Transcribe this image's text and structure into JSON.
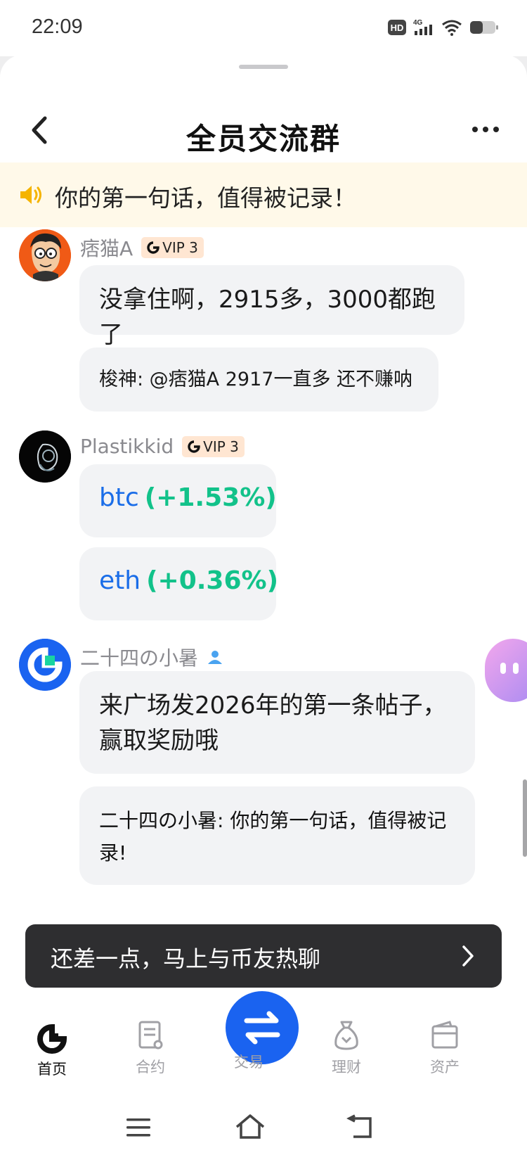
{
  "status_bar": {
    "time": "22:09",
    "network": "4G",
    "hd_label": "HD"
  },
  "header": {
    "title": "全员交流群",
    "back_icon": "chevron-left-icon",
    "more_icon": "more-horizontal-icon"
  },
  "notice": {
    "text": "你的第一句话，值得被记录！",
    "icon": "speaker-icon"
  },
  "messages": [
    {
      "user": "痞猫A",
      "badge": "VIP 3",
      "bubbles": [
        "没拿住啊，2915多，3000都跑了"
      ],
      "reply": "梭神: @痞猫A 2917一直多 还不赚呐"
    },
    {
      "user": "Plastikkid",
      "badge": "VIP 3",
      "tickers": [
        {
          "symbol": "btc",
          "change": "(+1.53%)"
        },
        {
          "symbol": "eth",
          "change": "(+0.36%)"
        }
      ]
    },
    {
      "user": "二十四の小暑",
      "badge_icon": "person-icon",
      "bubble_lines": [
        "来广场发2026年的第一条帖子，",
        "赢取奖励哦"
      ],
      "reply_lines": [
        "二十四の小暑: 你的第一句话，值得被记",
        "录!"
      ]
    }
  ],
  "cta": {
    "text": "还差一点，马上与币友热聊"
  },
  "tabs": [
    {
      "label": "首页",
      "icon": "home-logo-icon",
      "active": true
    },
    {
      "label": "合约",
      "icon": "contract-icon",
      "active": false
    },
    {
      "label": "交易",
      "icon": "swap-icon",
      "active": false
    },
    {
      "label": "理财",
      "icon": "money-bag-icon",
      "active": false
    },
    {
      "label": "资产",
      "icon": "wallet-icon",
      "active": false
    }
  ],
  "colors": {
    "accent": "#1a63f0",
    "positive": "#12c28a",
    "ticker": "#1a6de8",
    "notice_bg": "#fff9e9"
  }
}
